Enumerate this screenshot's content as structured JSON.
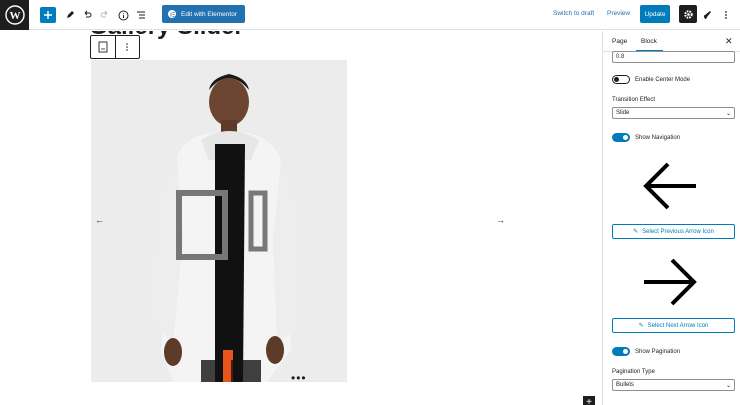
{
  "toolbar": {
    "elementor_label": "Edit with Elementor",
    "switch_draft_label": "Switch to draft",
    "preview_label": "Preview",
    "update_label": "Update"
  },
  "canvas": {
    "title": "Gallery Slider",
    "prev_arrow": "←",
    "next_arrow": "→",
    "pagination_dots": "•••"
  },
  "sidebar": {
    "tabs": [
      {
        "label": "Page"
      },
      {
        "label": "Block"
      }
    ],
    "top_value": "0.8",
    "center_mode_label": "Enable Center Mode",
    "center_mode_on": false,
    "transition_label": "Transition Effect",
    "transition_value": "Slide",
    "show_navigation_label": "Show Navigation",
    "show_navigation_on": true,
    "select_prev_label": "Select Previous Arrow Icon",
    "select_next_label": "Select Next Arrow Icon",
    "show_pagination_label": "Show Pagination",
    "show_pagination_on": true,
    "pagination_type_label": "Pagination Type",
    "pagination_type_value": "Bullets"
  },
  "colors": {
    "accent": "#007cba",
    "dark": "#1e1e1e"
  }
}
